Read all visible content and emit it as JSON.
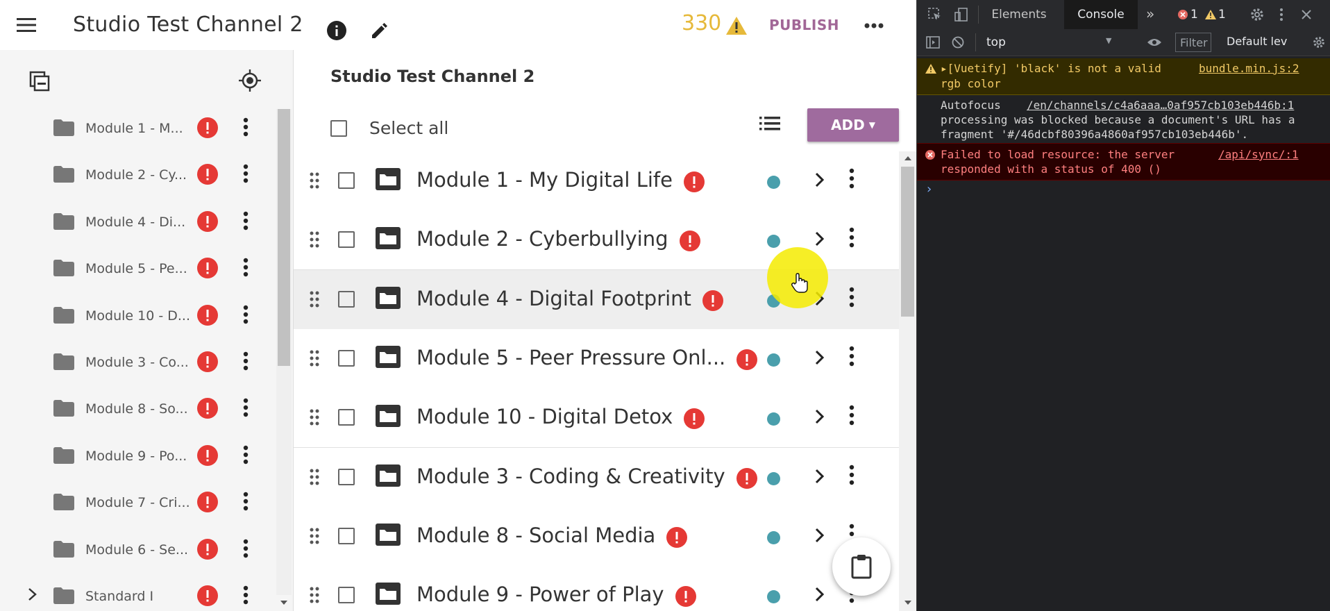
{
  "app": {
    "title": "Studio Test Channel 2",
    "issue_count": "330",
    "publish_label": "PUBLISH"
  },
  "sidebar": {
    "items": [
      {
        "label": "Module 1 - M..."
      },
      {
        "label": "Module 2 - Cy..."
      },
      {
        "label": "Module 4 - Di..."
      },
      {
        "label": "Module 5 - Pe..."
      },
      {
        "label": "Module 10 - D..."
      },
      {
        "label": "Module 3 - Co..."
      },
      {
        "label": "Module 8 - So..."
      },
      {
        "label": "Module 9 - Po..."
      },
      {
        "label": "Module 7 - Cri..."
      },
      {
        "label": "Module 6 - Se..."
      },
      {
        "label": "Standard I"
      }
    ]
  },
  "main": {
    "breadcrumb": "Studio Test Channel 2",
    "select_all_label": "Select all",
    "add_label": "ADD",
    "rows": [
      {
        "label": "Module 1 - My Digital Life"
      },
      {
        "label": "Module 2 - Cyberbullying"
      },
      {
        "label": "Module 4 - Digital Footprint"
      },
      {
        "label": "Module 5 - Peer Pressure Onl..."
      },
      {
        "label": "Module 10 - Digital Detox"
      },
      {
        "label": "Module 3 - Coding & Creativity"
      },
      {
        "label": "Module 8 - Social Media"
      },
      {
        "label": "Module 9 - Power of Play"
      }
    ]
  },
  "devtools": {
    "tabs": [
      "Elements",
      "Console"
    ],
    "error_count": "1",
    "warning_count": "1",
    "context": "top",
    "filter_placeholder": "Filter",
    "levels": "Default lev",
    "messages": {
      "warning": {
        "text1": "▸[Vuetify] 'black' is not a valid",
        "text2": "rgb color",
        "source": "bundle.min.js:2"
      },
      "info": {
        "text1": "Autofocus",
        "url": "/en/channels/c4a6aaa…0af957cb103eb446b:1",
        "text2": "processing was blocked because a document's URL has a",
        "text3": "fragment '#/46dcbf80396a4860af957cb103eb446b'."
      },
      "error": {
        "text1": "Failed to load resource: the server",
        "text2": "responded with a status of 400 ()",
        "source": "/api/sync/:1"
      }
    },
    "prompt": "›"
  },
  "colors": {
    "accent": "#9f6b9e",
    "warning": "#e6b93a",
    "error": "#e53935",
    "status_dot": "#4a9fac"
  }
}
